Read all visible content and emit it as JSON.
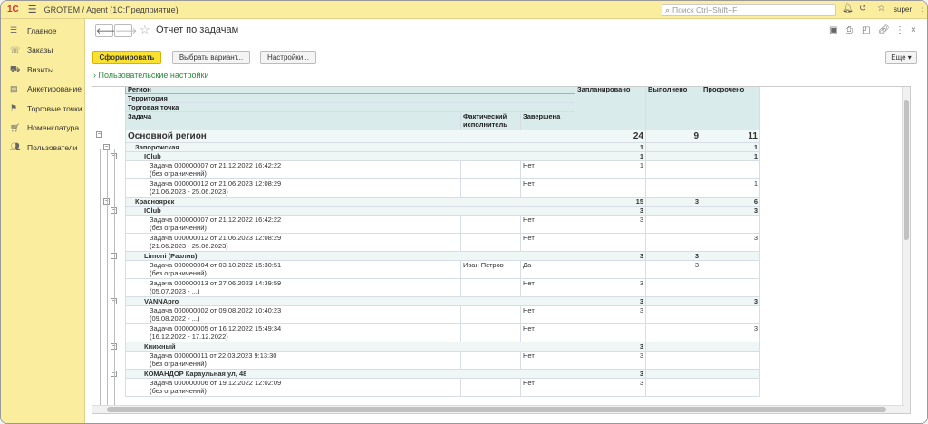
{
  "app": {
    "logo": "1С",
    "title": "GROTEM / Agent  (1С:Предприятие)",
    "search_placeholder": "Поиск Ctrl+Shift+F",
    "user": "super"
  },
  "sidebar": {
    "items": [
      {
        "label": "Главное",
        "icon": "menu-icon"
      },
      {
        "label": "Заказы",
        "icon": "phone-icon"
      },
      {
        "label": "Визиты",
        "icon": "car-icon"
      },
      {
        "label": "Анкетирование",
        "icon": "survey-icon"
      },
      {
        "label": "Торговые точки",
        "icon": "flag-icon"
      },
      {
        "label": "Номенклатура",
        "icon": "cart-icon"
      },
      {
        "label": "Пользователи",
        "icon": "users-icon"
      }
    ]
  },
  "doc": {
    "title": "Отчет по задачам"
  },
  "toolbar": {
    "generate": "Сформировать",
    "variant": "Выбрать вариант...",
    "settings": "Настройки...",
    "more": "Еще"
  },
  "settings_link": "Пользовательские настройки",
  "report": {
    "headers": {
      "region": "Регион",
      "territory": "Территория",
      "point": "Торговая точка",
      "task": "Задача",
      "executor": "Фактический исполнитель",
      "done": "Завершена",
      "planned": "Запланировано",
      "completed": "Выполнено",
      "overdue": "Просрочено"
    },
    "rows": [
      {
        "lvl": 0,
        "name": "Основной регион",
        "planned": "24",
        "completed": "9",
        "overdue": "11"
      },
      {
        "lvl": 1,
        "name": "Запорожская",
        "planned": "1",
        "completed": "",
        "overdue": "1"
      },
      {
        "lvl": 2,
        "name": "IClub",
        "planned": "1",
        "completed": "",
        "overdue": "1"
      },
      {
        "lvl": 3,
        "name": "Задача 000000007 от 21.12.2022 16:42:22",
        "sub": "(без ограничений)",
        "executor": "",
        "done": "Нет",
        "planned": "1",
        "completed": "",
        "overdue": ""
      },
      {
        "lvl": 3,
        "name": "Задача 000000012 от 21.06.2023 12:08:29",
        "sub": "(21.06.2023 - 25.06.2023)",
        "executor": "",
        "done": "Нет",
        "planned": "",
        "completed": "",
        "overdue": "1"
      },
      {
        "lvl": 1,
        "name": "Красноярск",
        "planned": "15",
        "completed": "3",
        "overdue": "6"
      },
      {
        "lvl": 2,
        "name": "IClub",
        "planned": "3",
        "completed": "",
        "overdue": "3"
      },
      {
        "lvl": 3,
        "name": "Задача 000000007 от 21.12.2022 16:42:22",
        "sub": "(без ограничений)",
        "executor": "",
        "done": "Нет",
        "planned": "3",
        "completed": "",
        "overdue": ""
      },
      {
        "lvl": 3,
        "name": "Задача 000000012 от 21.06.2023 12:08:29",
        "sub": "(21.06.2023 - 25.06.2023)",
        "executor": "",
        "done": "Нет",
        "planned": "",
        "completed": "",
        "overdue": "3"
      },
      {
        "lvl": 2,
        "name": "Limoni (Разлив)",
        "planned": "3",
        "completed": "3",
        "overdue": ""
      },
      {
        "lvl": 3,
        "name": "Задача 000000004 от 03.10.2022 15:30:51",
        "sub": "(без ограничений)",
        "executor": "Иван Петров",
        "done": "Да",
        "planned": "",
        "completed": "3",
        "overdue": ""
      },
      {
        "lvl": 3,
        "name": "Задача 000000013 от 27.06.2023 14:39:59",
        "sub": "(05.07.2023 - ...)",
        "executor": "",
        "done": "Нет",
        "planned": "3",
        "completed": "",
        "overdue": ""
      },
      {
        "lvl": 2,
        "name": "VANNApro",
        "planned": "3",
        "completed": "",
        "overdue": "3"
      },
      {
        "lvl": 3,
        "name": "Задача 000000002 от 09.08.2022 10:40:23",
        "sub": "(09.08.2022 - ...)",
        "executor": "",
        "done": "Нет",
        "planned": "3",
        "completed": "",
        "overdue": ""
      },
      {
        "lvl": 3,
        "name": "Задача 000000005 от 16.12.2022 15:49:34",
        "sub": "(16.12.2022 - 17.12.2022)",
        "executor": "",
        "done": "Нет",
        "planned": "",
        "completed": "",
        "overdue": "3"
      },
      {
        "lvl": 2,
        "name": "Книжный",
        "planned": "3",
        "completed": "",
        "overdue": ""
      },
      {
        "lvl": 3,
        "name": "Задача 000000011 от 22.03.2023 9:13:30",
        "sub": "(без ограничений)",
        "executor": "",
        "done": "Нет",
        "planned": "3",
        "completed": "",
        "overdue": ""
      },
      {
        "lvl": 2,
        "name": "КОМАНДОР Караульная ул, 48",
        "planned": "3",
        "completed": "",
        "overdue": ""
      },
      {
        "lvl": 3,
        "name": "Задача 000000006 от 19.12.2022 12:02:09",
        "sub": "(без ограничений)",
        "executor": "",
        "done": "Нет",
        "planned": "3",
        "completed": "",
        "overdue": ""
      }
    ]
  }
}
